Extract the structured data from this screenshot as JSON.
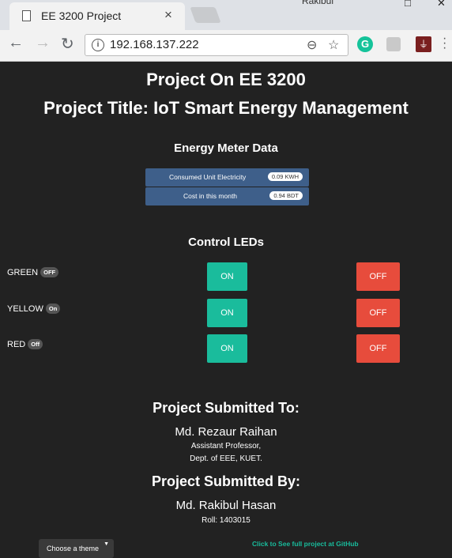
{
  "browser": {
    "user": "Rakibul",
    "tab_title": "EE 3200 Project",
    "url": "192.168.137.222"
  },
  "header": {
    "line1": "Project On EE 3200",
    "line2": "Project Title: IoT Smart Energy Management"
  },
  "meter": {
    "title": "Energy Meter Data",
    "rows": [
      {
        "label": "Consumed Unit Electricity",
        "value": "0.09 KWH"
      },
      {
        "label": "Cost in this month",
        "value": "0.94 BDT"
      }
    ]
  },
  "controls": {
    "title": "Control LEDs",
    "leds": [
      {
        "name": "GREEN",
        "status": "OFF",
        "on_label": "ON",
        "off_label": "OFF"
      },
      {
        "name": "YELLOW",
        "status": "On",
        "on_label": "ON",
        "off_label": "OFF"
      },
      {
        "name": "RED",
        "status": "Off",
        "on_label": "ON",
        "off_label": "OFF"
      }
    ]
  },
  "submitted_to": {
    "title": "Project Submitted To:",
    "name": "Md. Rezaur Raihan",
    "position": "Assistant Professor,",
    "dept": "Dept. of EEE, KUET."
  },
  "submitted_by": {
    "title": "Project Submitted By:",
    "name": "Md. Rakibul Hasan",
    "roll": "Roll: 1403015"
  },
  "footer": {
    "theme_label": "Choose a theme",
    "github_link": "Click to See full project at GitHub"
  },
  "colors": {
    "background": "#222222",
    "meter": "#3e5f8a",
    "on_button": "#1abc9c",
    "off_button": "#e74c3c",
    "link": "#18bc9c"
  }
}
